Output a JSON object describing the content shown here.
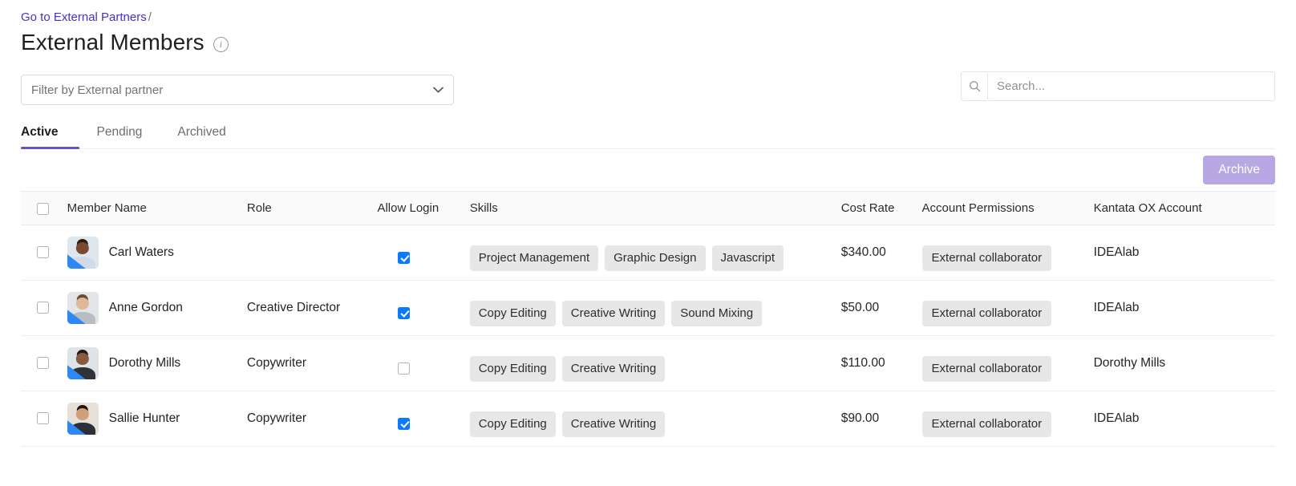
{
  "breadcrumb": {
    "link_label": "Go to External Partners",
    "separator": "/"
  },
  "header": {
    "title": "External Members",
    "info_icon": "info-icon",
    "info_glyph": "i"
  },
  "filter": {
    "placeholder": "Filter by External partner",
    "chevron_icon": "chevron-down-icon"
  },
  "search": {
    "placeholder": "Search...",
    "value": "",
    "icon": "search-icon"
  },
  "tabs": [
    {
      "label": "Active",
      "active": true
    },
    {
      "label": "Pending",
      "active": false
    },
    {
      "label": "Archived",
      "active": false
    }
  ],
  "actions": {
    "archive_label": "Archive"
  },
  "table": {
    "columns": [
      {
        "key": "select",
        "label": ""
      },
      {
        "key": "name",
        "label": "Member Name"
      },
      {
        "key": "role",
        "label": "Role"
      },
      {
        "key": "login",
        "label": "Allow Login"
      },
      {
        "key": "skills",
        "label": "Skills"
      },
      {
        "key": "cost",
        "label": "Cost Rate"
      },
      {
        "key": "permissions",
        "label": "Account Permissions"
      },
      {
        "key": "account",
        "label": "Kantata OX Account"
      }
    ],
    "select_all_checked": false,
    "rows": [
      {
        "selected": false,
        "name": "Carl Waters",
        "role": "",
        "allow_login": true,
        "skills": [
          "Project Management",
          "Graphic Design",
          "Javascript"
        ],
        "cost_rate": "$340.00",
        "permissions": "External collaborator",
        "account": "IDEAlab",
        "avatar": {
          "bg": "#dfe7ee",
          "skin": "#7a4a2e",
          "hair": "#2b1b12",
          "shirt": "#cfdbe6"
        }
      },
      {
        "selected": false,
        "name": "Anne Gordon",
        "role": "Creative Director",
        "allow_login": true,
        "skills": [
          "Copy Editing",
          "Creative Writing",
          "Sound Mixing"
        ],
        "cost_rate": "$50.00",
        "permissions": "External collaborator",
        "account": "IDEAlab",
        "avatar": {
          "bg": "#e3e6e9",
          "skin": "#e0b79a",
          "hair": "#6b4a32",
          "shirt": "#b9bcc2"
        }
      },
      {
        "selected": false,
        "name": "Dorothy Mills",
        "role": "Copywriter",
        "allow_login": false,
        "skills": [
          "Copy Editing",
          "Creative Writing"
        ],
        "cost_rate": "$110.00",
        "permissions": "External collaborator",
        "account": "Dorothy Mills",
        "avatar": {
          "bg": "#dde3e7",
          "skin": "#8a5a3c",
          "hair": "#241812",
          "shirt": "#2f3338"
        }
      },
      {
        "selected": false,
        "name": "Sallie Hunter",
        "role": "Copywriter",
        "allow_login": true,
        "skills": [
          "Copy Editing",
          "Creative Writing"
        ],
        "cost_rate": "$90.00",
        "permissions": "External collaborator",
        "account": "IDEAlab",
        "avatar": {
          "bg": "#e6e0da",
          "skin": "#cf9f7c",
          "hair": "#1d1410",
          "shirt": "#2a2f3a"
        }
      }
    ]
  },
  "colors": {
    "link": "#4b2fc4",
    "tab_accent": "#6b4fd0",
    "archive_button": "#b7a8e3",
    "checkbox_checked": "#0b7bfb",
    "chip_bg": "#e7e7e7",
    "header_bg": "#fafafa"
  }
}
